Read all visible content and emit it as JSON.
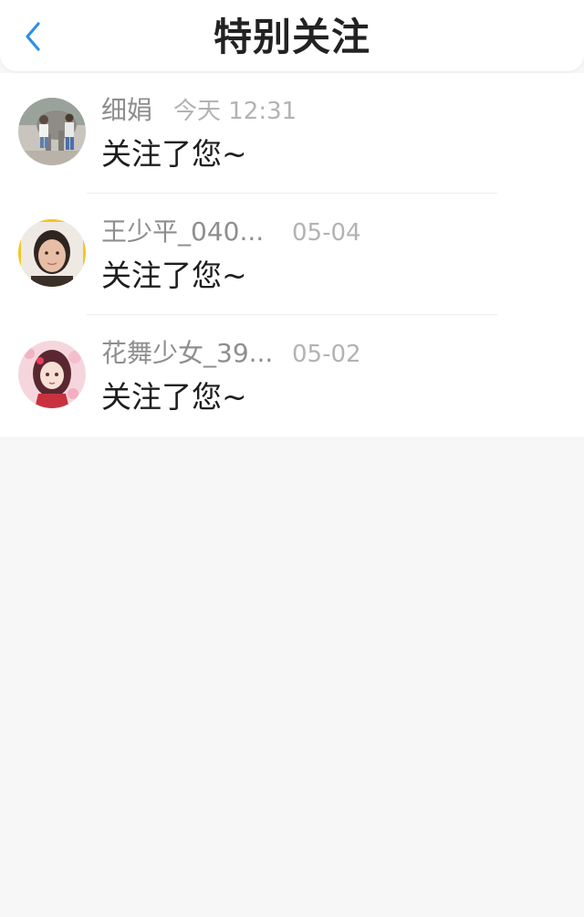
{
  "header": {
    "title": "特别关注",
    "back_icon": "chevron-left-icon",
    "accent_color": "#2f8ee8"
  },
  "followers": [
    {
      "name": "细娟",
      "time": "今天 12:31",
      "message": "关注了您~",
      "avatar": "photo-avatar-elephant"
    },
    {
      "name": "王少平_040...",
      "time": "05-04",
      "message": "关注了您~",
      "avatar": "photo-avatar-woman"
    },
    {
      "name": "花舞少女_39...",
      "time": "05-02",
      "message": "关注了您~",
      "avatar": "anime-girl-avatar"
    }
  ]
}
